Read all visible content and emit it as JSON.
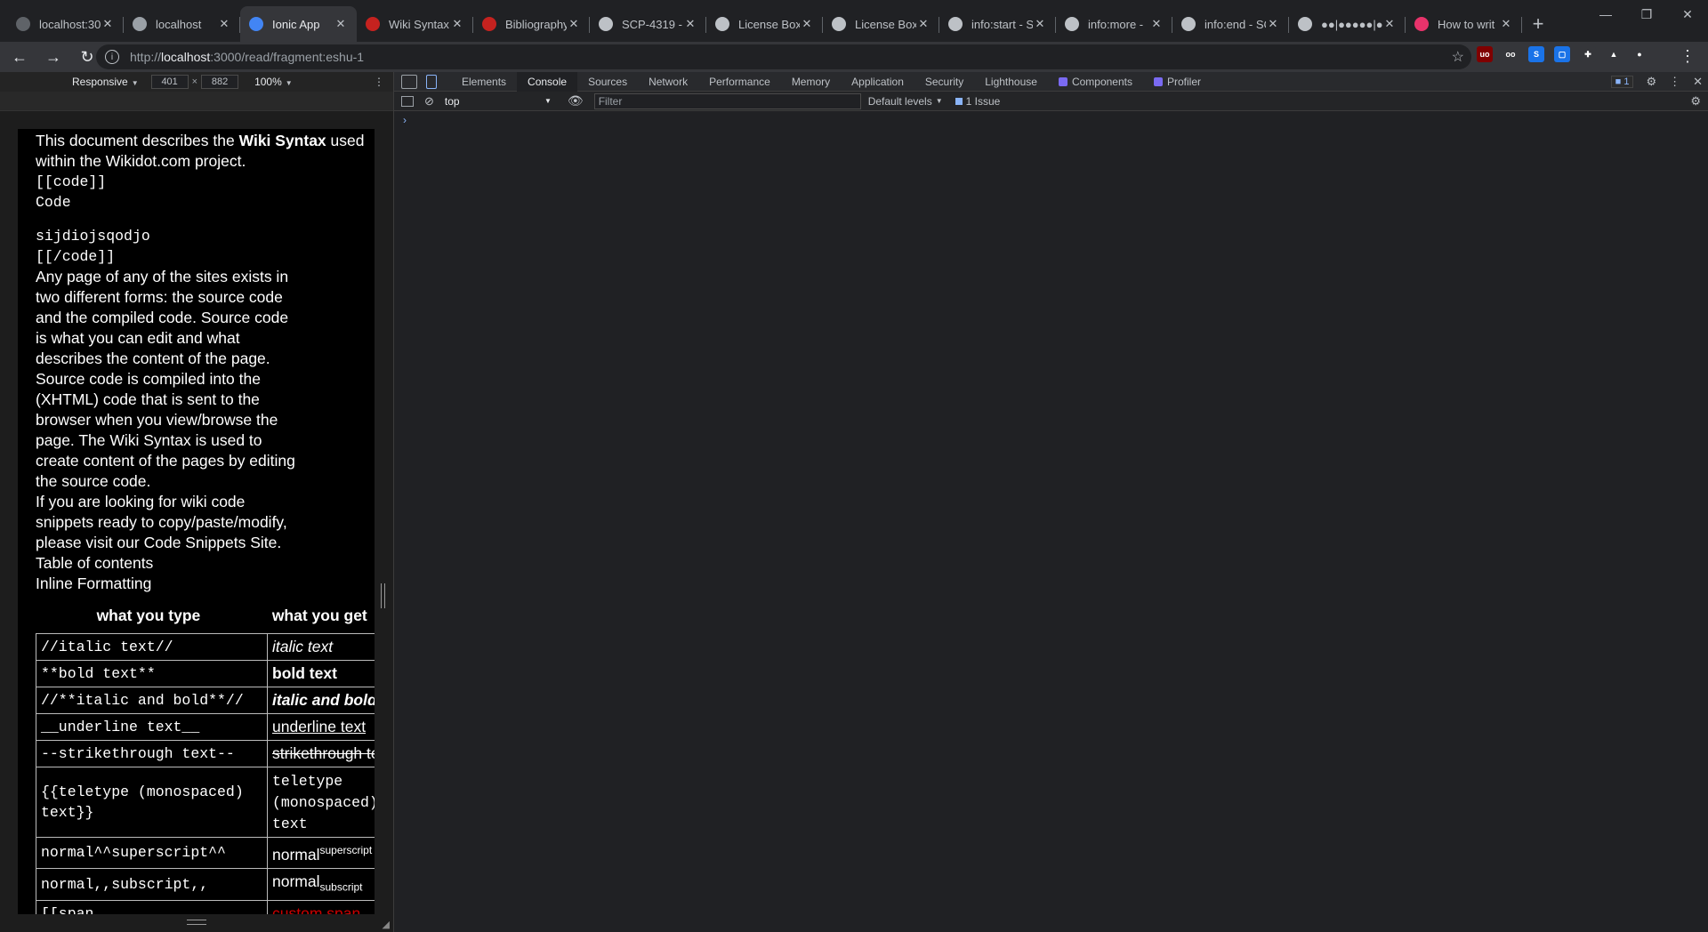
{
  "tabs": [
    {
      "label": "localhost:30",
      "favicon_color": "#5f6368",
      "active": false
    },
    {
      "label": "localhost",
      "favicon_color": "#9aa0a6",
      "active": false
    },
    {
      "label": "Ionic App",
      "favicon_color": "#4285f4",
      "active": true
    },
    {
      "label": "Wiki Syntax",
      "favicon_color": "#c5221f",
      "active": false
    },
    {
      "label": "Bibliography",
      "favicon_color": "#c5221f",
      "active": false
    },
    {
      "label": "SCP-4319 -",
      "favicon_color": "#bdc1c6",
      "active": false
    },
    {
      "label": "License Box",
      "favicon_color": "#bdc1c6",
      "active": false
    },
    {
      "label": "License Box",
      "favicon_color": "#bdc1c6",
      "active": false
    },
    {
      "label": "info:start - S",
      "favicon_color": "#bdc1c6",
      "active": false
    },
    {
      "label": "info:more -",
      "favicon_color": "#bdc1c6",
      "active": false
    },
    {
      "label": "info:end - SC",
      "favicon_color": "#bdc1c6",
      "active": false
    },
    {
      "label": "●●|●●●●●|●",
      "favicon_color": "#bdc1c6",
      "active": false
    },
    {
      "label": "How to writ",
      "favicon_color": "#e8336b",
      "active": false
    }
  ],
  "new_tab_icon": "+",
  "address_bar": {
    "host": "localhost",
    "scheme": "http://",
    "path": ":3000/read/fragment:eshu-1"
  },
  "extensions": [
    {
      "name": "ublock-icon",
      "color": "#800000",
      "label": "uo"
    },
    {
      "name": "glasses-icon",
      "color": "#35363a",
      "label": "oo"
    },
    {
      "name": "s-extension-icon",
      "color": "#1a73e8",
      "label": "S"
    },
    {
      "name": "screen-icon",
      "color": "#1a73e8",
      "label": "▢"
    },
    {
      "name": "puzzle-icon",
      "color": "#35363a",
      "label": "✚"
    },
    {
      "name": "flask-icon",
      "color": "#35363a",
      "label": "▲"
    },
    {
      "name": "profile-icon",
      "color": "#35363a",
      "label": "●"
    }
  ],
  "device_toolbar": {
    "mode": "Responsive",
    "width": "401",
    "height": "882",
    "zoom": "100%"
  },
  "page": {
    "intro_prefix": "This document describes the ",
    "intro_bold": "Wiki Syntax",
    "intro_suffix": " used within the Wikidot.com project.",
    "code_open": "[[code]]",
    "code_line1": "Code",
    "code_line2": "sijdiojsqodjo",
    "code_close": "[[/code]]",
    "para1": "Any page of any of the sites exists in two different forms: the source code and the compiled code. Source code is what you can edit and what describes the content of the page. Source code is compiled into the (XHTML) code that is sent to the browser when you view/browse the page. The Wiki Syntax is used to create content of the pages by editing the source code.",
    "para2": "If you are looking for wiki code snippets ready to copy/paste/modify, please visit our Code Snippets Site.",
    "toc": "Table of contents",
    "section": "Inline Formatting",
    "col_type": "what you type",
    "col_get": "what you get",
    "rows": [
      {
        "src": "//italic text//",
        "out": "italic text"
      },
      {
        "src": "**bold text**",
        "out": "bold text"
      },
      {
        "src": "//**italic and bold**//",
        "out": "italic and bold"
      },
      {
        "src": "__underline text__",
        "out": "underline text"
      },
      {
        "src": "--strikethrough text--",
        "out": "strikethrough text"
      },
      {
        "src": "{{teletype (monospaced) text}}",
        "out": "teletype (monospaced) text"
      },
      {
        "src": "normal^^superscript^^",
        "out_base": "normal",
        "out_mod": "superscript"
      },
      {
        "src": "normal,,subscript,,",
        "out_base": "normal",
        "out_mod": "subscript"
      },
      {
        "src": "[[span",
        "out": "custom span"
      }
    ]
  },
  "devtools": {
    "tabs": [
      "Elements",
      "Console",
      "Sources",
      "Network",
      "Performance",
      "Memory",
      "Application",
      "Security",
      "Lighthouse",
      "Components",
      "Profiler"
    ],
    "active_tab": "Console",
    "issues_badge": "1",
    "context": "top",
    "filter_placeholder": "Filter",
    "levels": "Default levels",
    "issues_label": "1 Issue",
    "prompt": "›"
  }
}
